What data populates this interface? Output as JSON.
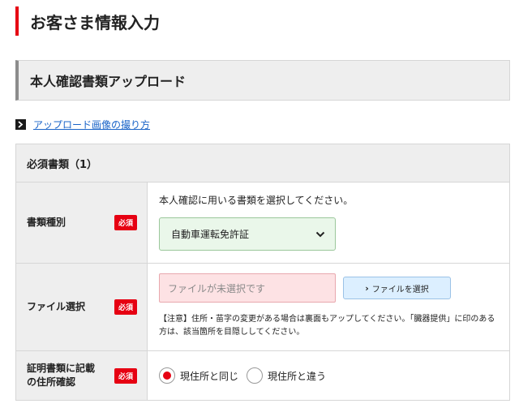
{
  "page": {
    "title": "お客さま情報入力"
  },
  "section": {
    "title": "本人確認書類アップロード"
  },
  "howto": {
    "link_label": "アップロード画像の撮り方"
  },
  "table": {
    "header": "必須書類（1）",
    "required_badge": "必須",
    "doc_type": {
      "label": "書類種別",
      "instruction": "本人確認に用いる書類を選択してください。",
      "selected": "自動車運転免許証"
    },
    "file": {
      "label": "ファイル選択",
      "placeholder": "ファイルが未選択です",
      "button_label": "ファイルを選択",
      "note": "【注意】住所・苗字の変更がある場合は裏面もアップしてください。「臓器提供」に印のある方は、該当箇所を目隠ししてください。"
    },
    "address": {
      "label": "証明書類に記載の住所確認",
      "options": [
        {
          "label": "現住所と同じ",
          "checked": true
        },
        {
          "label": "現住所と違う",
          "checked": false
        }
      ]
    }
  },
  "colors": {
    "accent": "#e60012",
    "link": "#1a64c8",
    "select_bg": "#eaf7ea",
    "file_bg": "#fde2e4",
    "button_bg": "#dcefff"
  }
}
